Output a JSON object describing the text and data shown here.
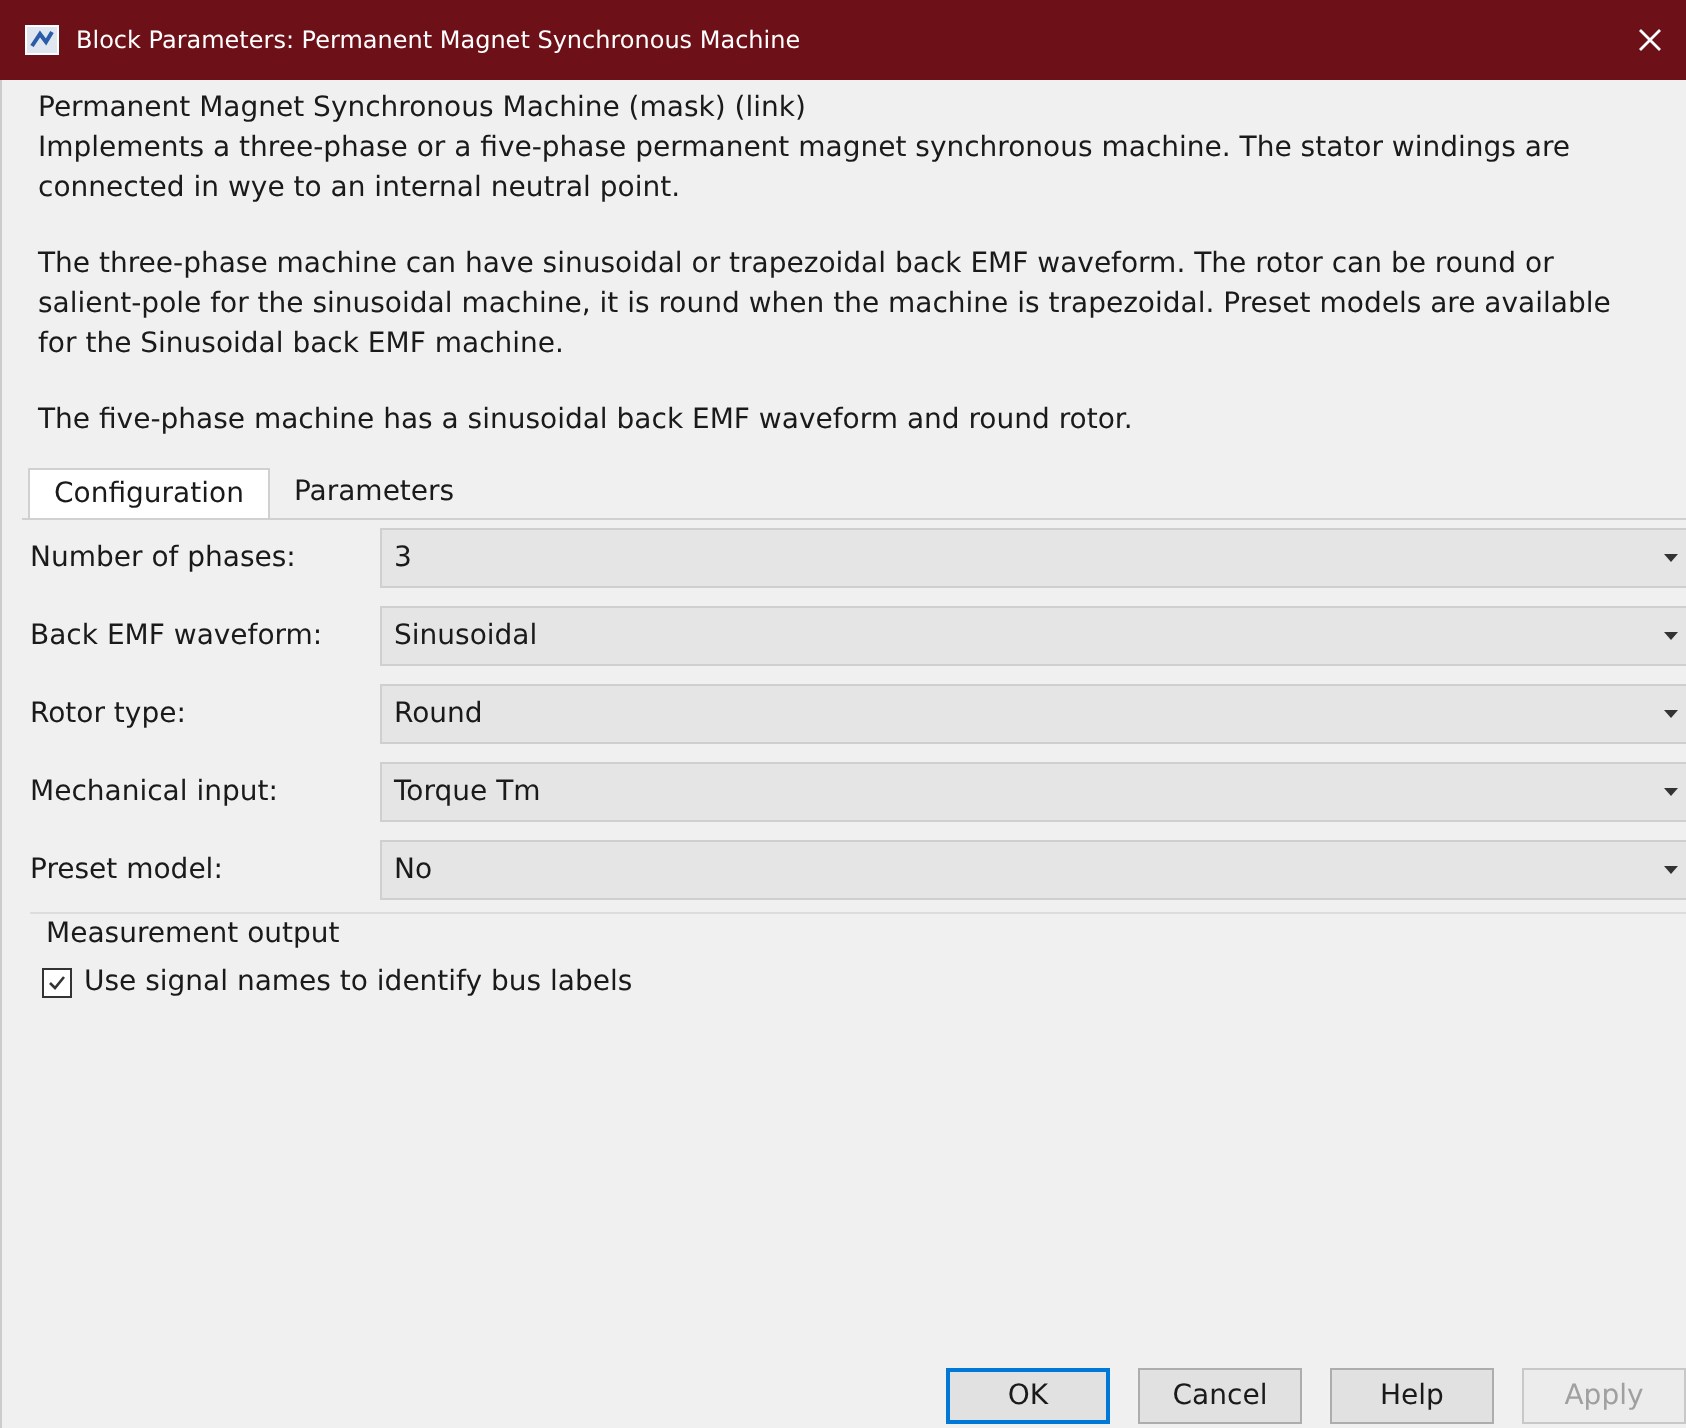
{
  "window": {
    "title": "Block Parameters: Permanent Magnet Synchronous Machine"
  },
  "description": {
    "heading": "Permanent Magnet Synchronous Machine (mask) (link)",
    "paragraphs": [
      "Implements a three-phase or a five-phase permanent magnet synchronous machine. The stator windings are connected in wye to an internal neutral point.",
      "The three-phase machine can have sinusoidal or trapezoidal back EMF waveform. The rotor can be round or salient-pole for the sinusoidal machine, it is round when the machine is trapezoidal. Preset models are available for the Sinusoidal back EMF machine.",
      "The five-phase machine has a sinusoidal back EMF waveform and round rotor."
    ]
  },
  "tabs": [
    {
      "label": "Configuration",
      "selected": true
    },
    {
      "label": "Parameters",
      "selected": false
    }
  ],
  "fields": [
    {
      "label": "Number of phases:",
      "value": "3"
    },
    {
      "label": "Back EMF waveform:",
      "value": "Sinusoidal"
    },
    {
      "label": "Rotor type:",
      "value": "Round"
    },
    {
      "label": "Mechanical input:",
      "value": "Torque Tm"
    },
    {
      "label": "Preset model:",
      "value": "No"
    }
  ],
  "measurement": {
    "title": "Measurement output",
    "checkbox": {
      "label": "Use signal names to identify bus labels",
      "checked": true
    }
  },
  "buttons": [
    {
      "label": "OK",
      "disabled": false,
      "default": true
    },
    {
      "label": "Cancel",
      "disabled": false,
      "default": false
    },
    {
      "label": "Help",
      "disabled": false,
      "default": false
    },
    {
      "label": "Apply",
      "disabled": true,
      "default": false
    }
  ]
}
